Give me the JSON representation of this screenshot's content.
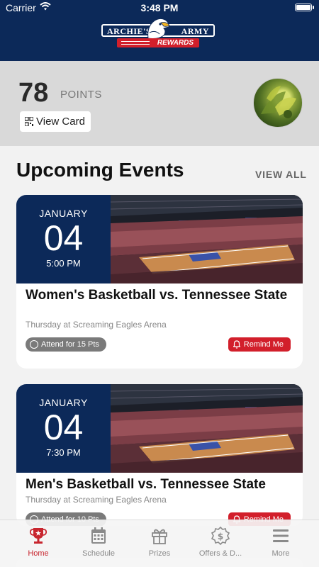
{
  "status_bar": {
    "carrier": "Carrier",
    "time": "3:48 PM"
  },
  "brand": {
    "left": "ARCHIE'S",
    "right": "ARMY",
    "sub": "REWARDS",
    "accent": "#d21f2b",
    "navy": "#0c2959"
  },
  "points": {
    "value": "78",
    "label": "POINTS",
    "view_card": "View Card"
  },
  "events_section": {
    "title": "Upcoming Events",
    "view_all": "VIEW ALL"
  },
  "events": [
    {
      "month": "JANUARY",
      "day": "04",
      "time": "5:00 PM",
      "title": "Women's Basketball vs. Tennessee State",
      "subtitle": "Thursday at Screaming Eagles Arena",
      "attend": "Attend for 15 Pts",
      "remind": "Remind Me"
    },
    {
      "month": "JANUARY",
      "day": "04",
      "time": "7:30 PM",
      "title": "Men's Basketball vs. Tennessee State",
      "subtitle": "Thursday at Screaming Eagles Arena",
      "attend": "Attend for 10 Pts",
      "remind": "Remind Me"
    }
  ],
  "tabs": [
    {
      "label": "Home",
      "icon": "trophy-icon",
      "active": true
    },
    {
      "label": "Schedule",
      "icon": "calendar-icon",
      "active": false
    },
    {
      "label": "Prizes",
      "icon": "gift-icon",
      "active": false
    },
    {
      "label": "Offers & D...",
      "icon": "dollar-badge-icon",
      "active": false
    },
    {
      "label": "More",
      "icon": "menu-icon",
      "active": false
    }
  ]
}
